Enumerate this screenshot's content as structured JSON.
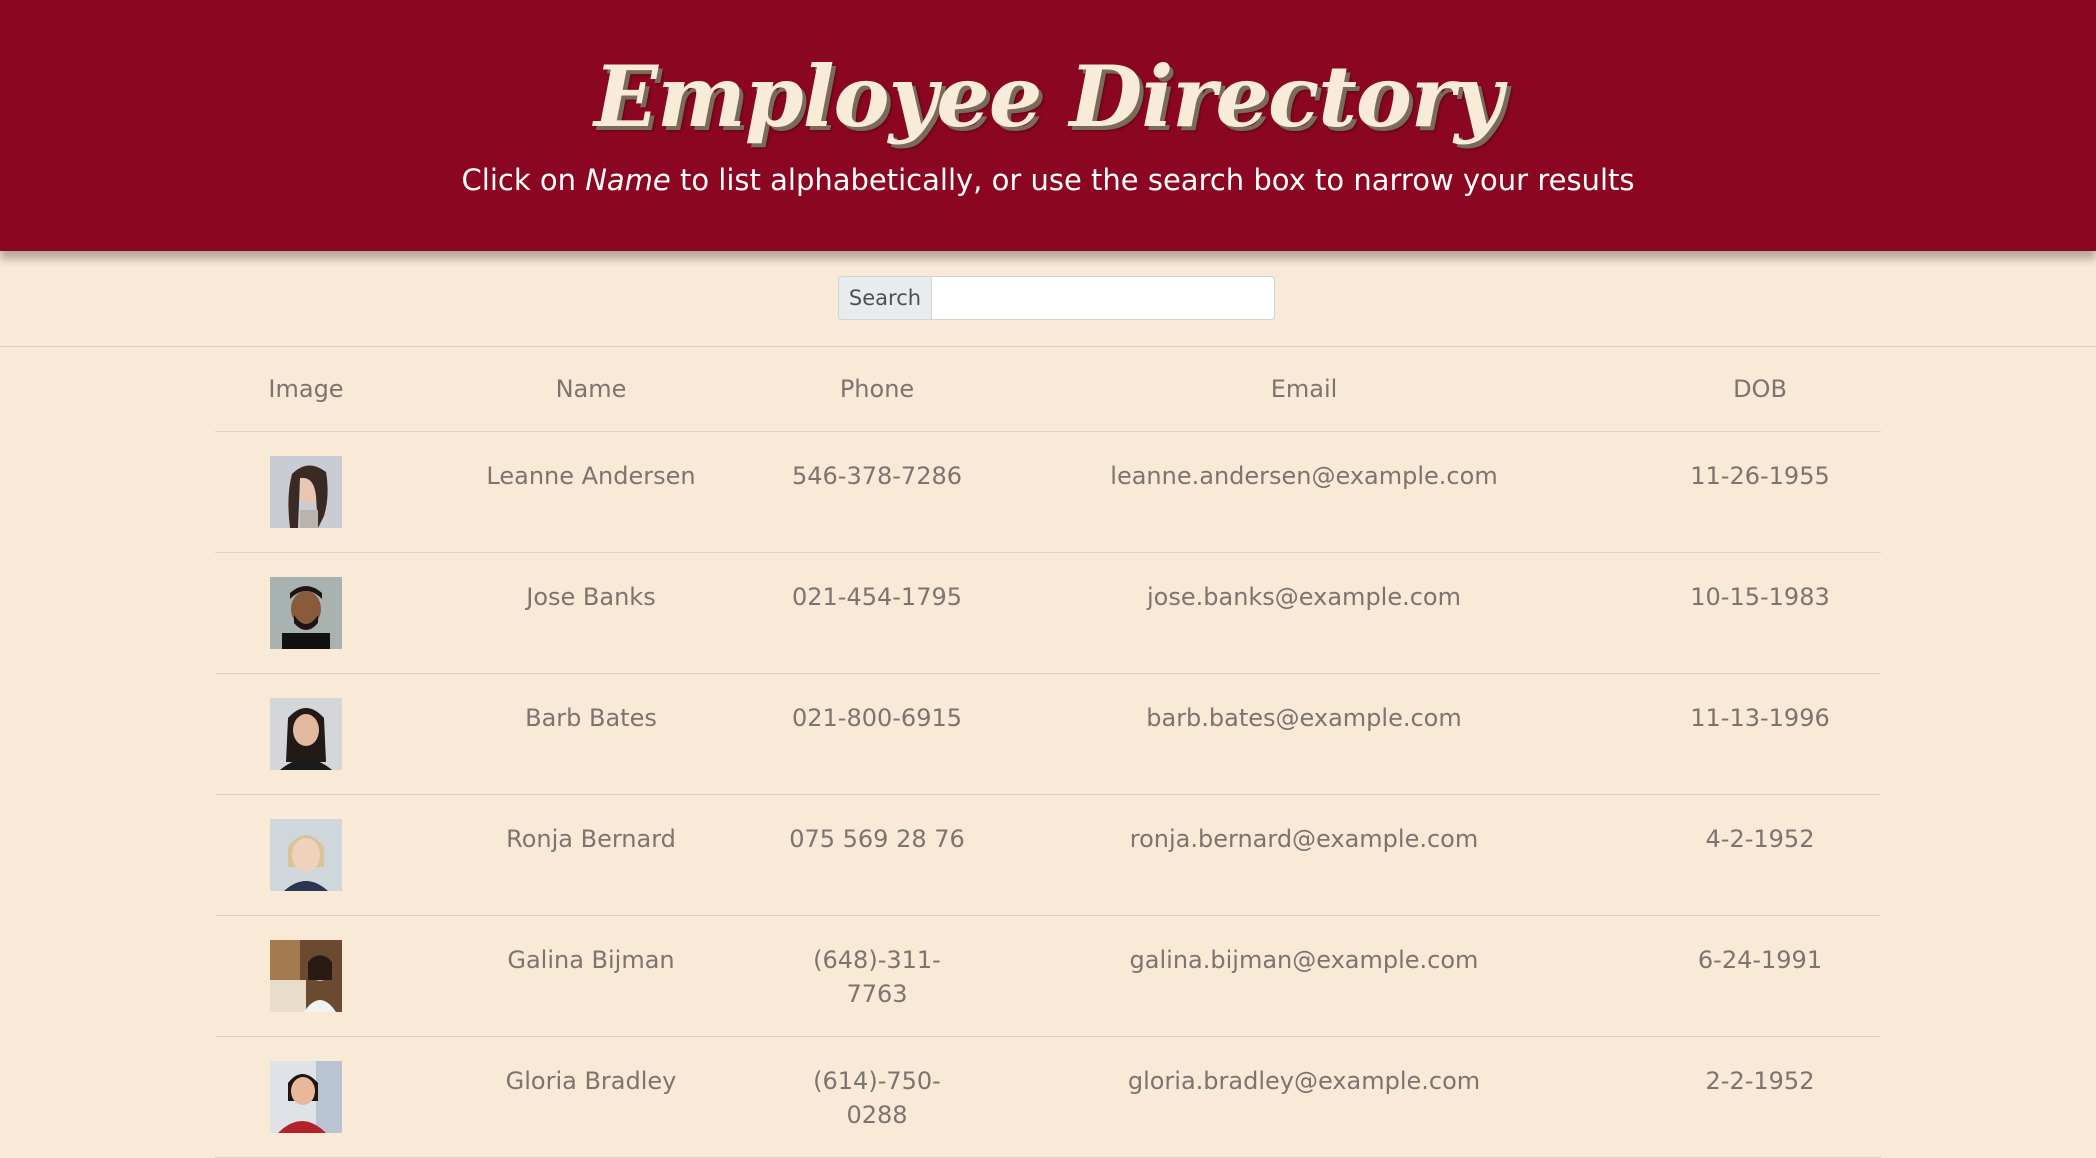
{
  "header": {
    "title": "Employee Directory",
    "subtitle_before": "Click on ",
    "subtitle_emphasis": "Name",
    "subtitle_after": " to list alphabetically, or use the search box to narrow your results"
  },
  "search": {
    "label": "Search",
    "value": ""
  },
  "table": {
    "columns": [
      "Image",
      "Name",
      "Phone",
      "Email",
      "DOB"
    ],
    "rows": [
      {
        "name": "Leanne Andersen",
        "phone": "546-378-7286",
        "email": "leanne.andersen@example.com",
        "dob": "11-26-1955"
      },
      {
        "name": "Jose Banks",
        "phone": "021-454-1795",
        "email": "jose.banks@example.com",
        "dob": "10-15-1983"
      },
      {
        "name": "Barb Bates",
        "phone": "021-800-6915",
        "email": "barb.bates@example.com",
        "dob": "11-13-1996"
      },
      {
        "name": "Ronja Bernard",
        "phone": "075 569 28 76",
        "email": "ronja.bernard@example.com",
        "dob": "4-2-1952"
      },
      {
        "name": "Galina Bijman",
        "phone": "(648)-311-7763",
        "email": "galina.bijman@example.com",
        "dob": "6-24-1991"
      },
      {
        "name": "Gloria Bradley",
        "phone": "(614)-750-0288",
        "email": "gloria.bradley@example.com",
        "dob": "2-2-1952"
      }
    ]
  },
  "colors": {
    "header_bg": "#8b0620",
    "page_bg": "#f9e9d7",
    "title_text": "#f8ecd9",
    "table_text": "#7d7470"
  },
  "icons": {
    "avatar": "employee-photo"
  }
}
